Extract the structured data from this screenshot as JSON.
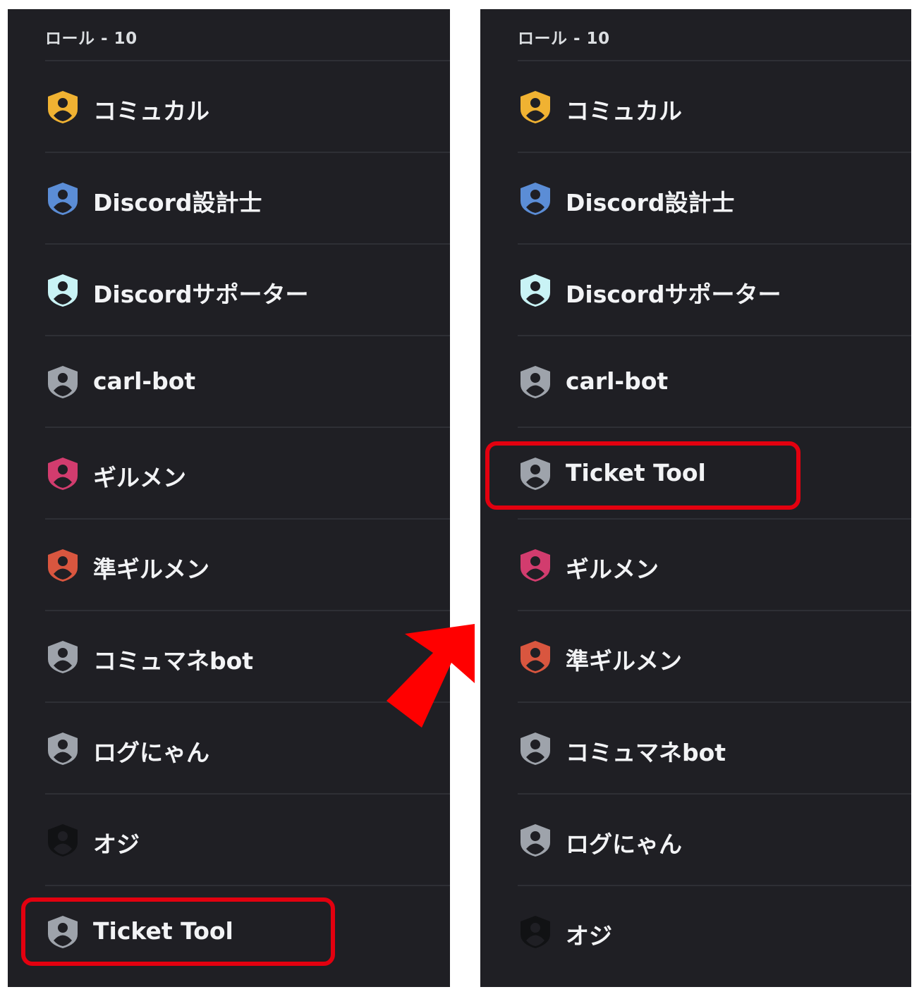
{
  "left_panel": {
    "header": "ロール - 10",
    "roles": [
      {
        "label": "コミュカル",
        "color": "#f0b232"
      },
      {
        "label": "Discord設計士",
        "color": "#5b8dd6"
      },
      {
        "label": "Discordサポーター",
        "color": "#c9f3f5"
      },
      {
        "label": "carl-bot",
        "color": "#9ea3ab"
      },
      {
        "label": "ギルメン",
        "color": "#d23c6e"
      },
      {
        "label": "準ギルメン",
        "color": "#d9563f"
      },
      {
        "label": "コミュマネbot",
        "color": "#9ea3ab"
      },
      {
        "label": "ログにゃん",
        "color": "#9ea3ab"
      },
      {
        "label": "オジ",
        "color": "#111214"
      },
      {
        "label": "Ticket Tool",
        "color": "#9ea3ab"
      }
    ]
  },
  "right_panel": {
    "header": "ロール - 10",
    "roles": [
      {
        "label": "コミュカル",
        "color": "#f0b232"
      },
      {
        "label": "Discord設計士",
        "color": "#5b8dd6"
      },
      {
        "label": "Discordサポーター",
        "color": "#c9f3f5"
      },
      {
        "label": "carl-bot",
        "color": "#9ea3ab"
      },
      {
        "label": "Ticket Tool",
        "color": "#9ea3ab"
      },
      {
        "label": "ギルメン",
        "color": "#d23c6e"
      },
      {
        "label": "準ギルメン",
        "color": "#d9563f"
      },
      {
        "label": "コミュマネbot",
        "color": "#9ea3ab"
      },
      {
        "label": "ログにゃん",
        "color": "#9ea3ab"
      },
      {
        "label": "オジ",
        "color": "#111214"
      }
    ]
  },
  "annotations": {
    "highlight_color": "#e3000f",
    "arrow_color": "#ff0000"
  }
}
